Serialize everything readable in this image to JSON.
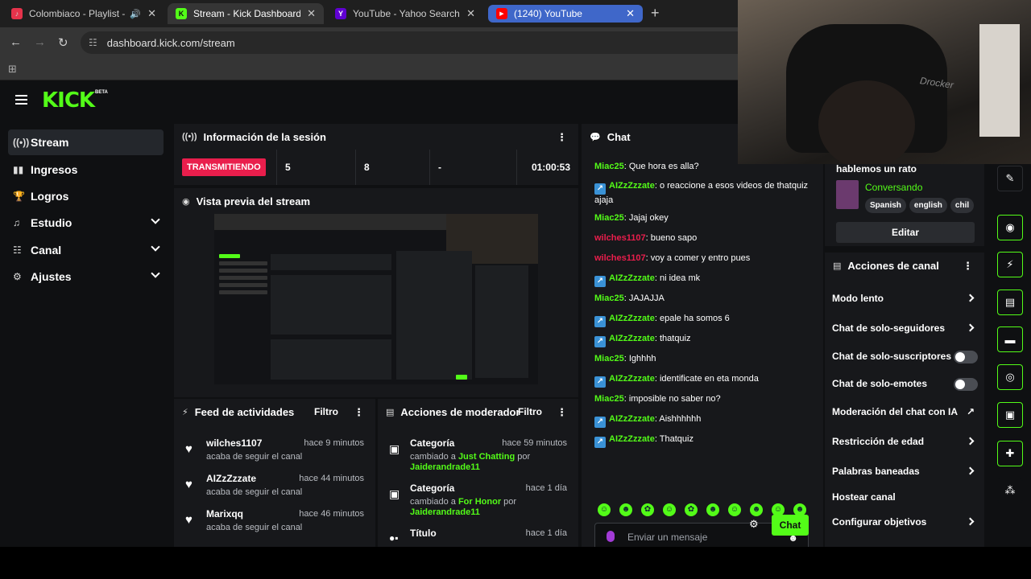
{
  "browser": {
    "tabs": [
      {
        "title": "Colombiaco - Playlist - App",
        "favicon": "music-favicon",
        "color": "#e5334b"
      },
      {
        "title": "Stream - Kick Dashboard",
        "favicon": "kick-favicon",
        "color": "#53fc18"
      },
      {
        "title": "YouTube - Yahoo Search Result",
        "favicon": "yahoo-favicon",
        "color": "#6001d2"
      },
      {
        "title": "(1240) YouTube",
        "favicon": "youtube-favicon",
        "color": "#ff0000"
      }
    ],
    "url": "dashboard.kick.com/stream"
  },
  "brand": {
    "logo": "KICK",
    "beta": "BETA",
    "accent": "#53fc18"
  },
  "sidebar": {
    "items": [
      {
        "label": "Stream",
        "icon": "broadcast-icon"
      },
      {
        "label": "Ingresos",
        "icon": "chart-icon"
      },
      {
        "label": "Logros",
        "icon": "trophy-icon"
      },
      {
        "label": "Estudio",
        "icon": "studio-icon"
      },
      {
        "label": "Canal",
        "icon": "channel-icon"
      },
      {
        "label": "Ajustes",
        "icon": "gear-icon"
      }
    ]
  },
  "session": {
    "title": "Información de la sesión",
    "status": "TRANSMITIENDO",
    "viewers": "5",
    "followers": "8",
    "dash": "-",
    "duration": "01:00:53"
  },
  "preview": {
    "title": "Vista previa del stream"
  },
  "feed": {
    "title": "Feed de actividades",
    "filter": "Filtro",
    "items": [
      {
        "name": "wilches1107",
        "text": "acaba de seguir el canal",
        "time": "hace 9 minutos"
      },
      {
        "name": "AIZzZzzate",
        "text": "acaba de seguir el canal",
        "time": "hace 44 minutos"
      },
      {
        "name": "Marixqq",
        "text": "acaba de seguir el canal",
        "time": "hace 46 minutos"
      }
    ]
  },
  "mod": {
    "title": "Acciones de moderador",
    "filter": "Filtro",
    "items": [
      {
        "name": "Categoría",
        "pre": "cambiado a ",
        "value": "Just Chatting",
        "mid": " por ",
        "user": "Jaiderandrade11",
        "time": "hace 59 minutos"
      },
      {
        "name": "Categoría",
        "pre": "cambiado a ",
        "value": "For Honor",
        "mid": " por ",
        "user": "Jaiderandrade11",
        "time": "hace 1 día"
      },
      {
        "name": "Título",
        "time": "hace 1 día"
      }
    ]
  },
  "chat": {
    "title": "Chat",
    "messages": [
      {
        "user": "Miac25",
        "text": "Que hora es alla?",
        "color": "#53fc18",
        "badge": false
      },
      {
        "user": "AIZzZzzate",
        "text": "o reaccione a esos videos de thatquiz ajaja",
        "color": "#53fc18",
        "badge": true
      },
      {
        "user": "Miac25",
        "text": "Jajaj okey",
        "color": "#53fc18",
        "badge": false
      },
      {
        "user": "wilches1107",
        "text": "bueno sapo",
        "color": "#e91e4c",
        "badge": false
      },
      {
        "user": "wilches1107",
        "text": "voy a comer y entro pues",
        "color": "#e91e4c",
        "badge": false
      },
      {
        "user": "AIZzZzzate",
        "text": "ni idea mk",
        "color": "#53fc18",
        "badge": true
      },
      {
        "user": "Miac25",
        "text": "JAJAJJA",
        "color": "#53fc18",
        "badge": false
      },
      {
        "user": "AIZzZzzate",
        "text": "epale ha somos 6",
        "color": "#53fc18",
        "badge": true
      },
      {
        "user": "AIZzZzzate",
        "text": "thatquiz",
        "color": "#53fc18",
        "badge": true
      },
      {
        "user": "Miac25",
        "text": "Ighhhh",
        "color": "#53fc18",
        "badge": false
      },
      {
        "user": "AIZzZzzate",
        "text": "identificate en eta monda",
        "color": "#53fc18",
        "badge": true
      },
      {
        "user": "Miac25",
        "text": "imposible no saber no?",
        "color": "#53fc18",
        "badge": false
      },
      {
        "user": "AIZzZzzate",
        "text": "Aishhhhhh",
        "color": "#53fc18",
        "badge": true
      },
      {
        "user": "AIZzZzzate",
        "text": "Thatquiz",
        "color": "#53fc18",
        "badge": true
      }
    ],
    "input_placeholder": "Enviar un mensaje",
    "send_label": "Chat"
  },
  "stream_info": {
    "title": "hablemos un rato",
    "category": "Conversando",
    "tags": [
      "Spanish",
      "english",
      "chil"
    ],
    "edit_label": "Editar"
  },
  "channel_actions": {
    "title": "Acciones de canal",
    "items": [
      {
        "label": "Modo lento",
        "control": "arrow"
      },
      {
        "label": "Chat de solo-seguidores",
        "control": "arrow"
      },
      {
        "label": "Chat de solo-suscriptores",
        "control": "toggle"
      },
      {
        "label": "Chat de solo-emotes",
        "control": "toggle"
      },
      {
        "label": "Moderación del chat con IA",
        "control": "external"
      },
      {
        "label": "Restricción de edad",
        "control": "arrow"
      },
      {
        "label": "Palabras baneadas",
        "control": "arrow"
      },
      {
        "label": "Hostear canal",
        "control": "none"
      },
      {
        "label": "Configurar objetivos",
        "control": "arrow"
      }
    ]
  },
  "webcam": {
    "brand": "Drocker"
  }
}
